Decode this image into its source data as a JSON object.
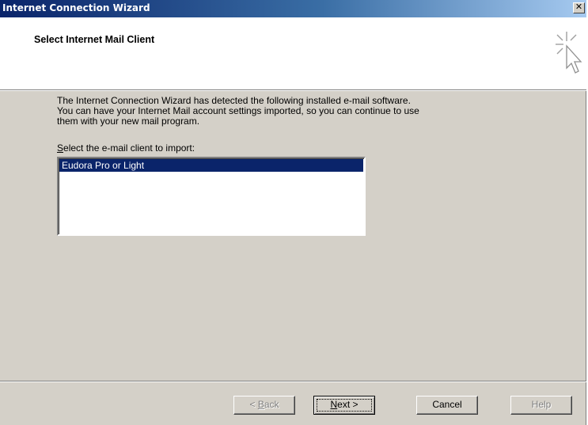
{
  "window": {
    "title": "Internet Connection Wizard",
    "close_glyph": "✕"
  },
  "header": {
    "title": "Select Internet Mail Client",
    "icon": "wizard-cursor-icon"
  },
  "description": {
    "line1": "The Internet Connection Wizard has detected the following installed e-mail software.",
    "line2": "You can have your Internet Mail account settings imported, so you can continue to use",
    "line3": "them with your new mail program."
  },
  "client_list": {
    "label_access_key": "S",
    "label_rest": "elect the e-mail client to import:",
    "items": [
      "Eudora Pro or Light"
    ],
    "selected_index": 0
  },
  "buttons": {
    "back": {
      "prefix": "< ",
      "access_key": "B",
      "rest": "ack",
      "enabled": false
    },
    "next": {
      "access_key": "N",
      "rest": "ext >",
      "enabled": true
    },
    "cancel": {
      "label": "Cancel",
      "enabled": true
    },
    "help": {
      "label": "Help",
      "enabled": false
    }
  },
  "colors": {
    "title_bar": "#0a246a",
    "face": "#d4d0c8",
    "selection": "#0a246a"
  }
}
